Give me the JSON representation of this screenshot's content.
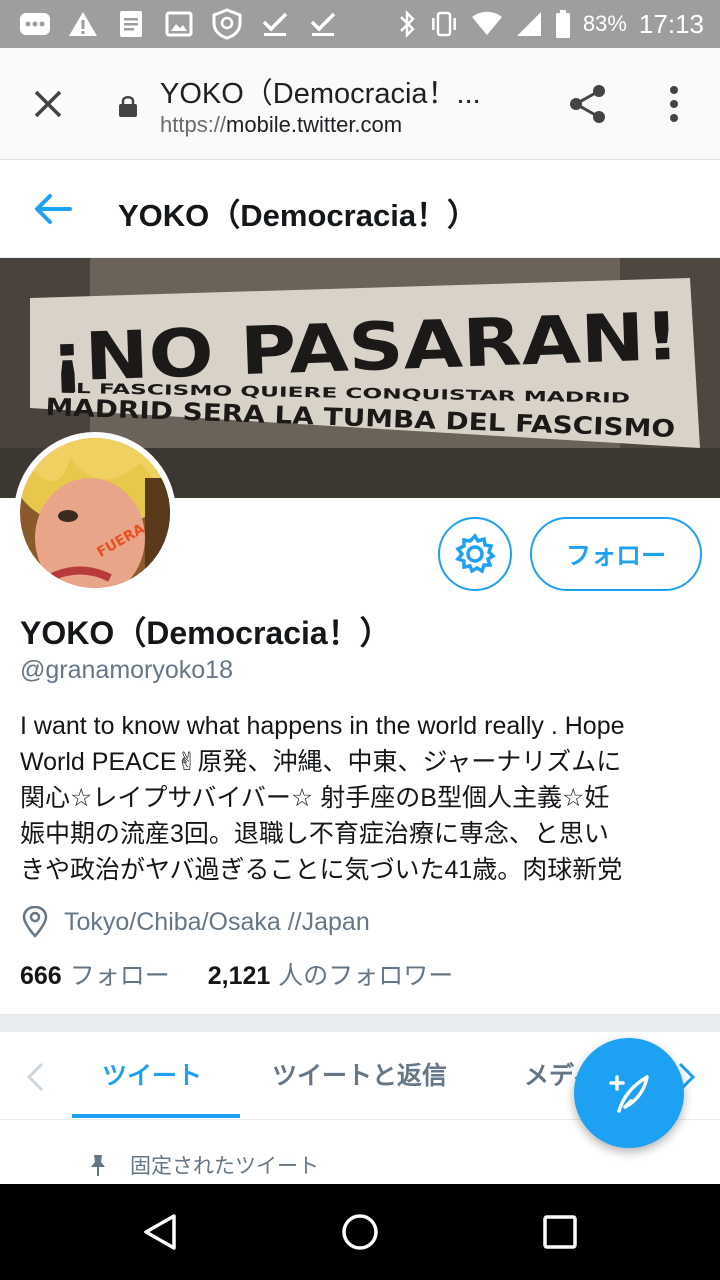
{
  "status_bar": {
    "battery": "83%",
    "time": "17:13"
  },
  "browser": {
    "title": "YOKO（Democracia！...",
    "url_scheme": "https://",
    "url_host": "mobile.twitter.com"
  },
  "header": {
    "title": "YOKO（Democracia！）"
  },
  "banner": {
    "text_main": "¡NO PASARAN!",
    "text_line2": "EL FASCISMO QUIERE CONQUISTAR MADRID",
    "text_line3": "MADRID SERA LA TUMBA DEL FASCISMO"
  },
  "avatar": {
    "face_text": "FUERA ABE"
  },
  "profile": {
    "follow_label": "フォロー",
    "name": "YOKO（Democracia！）",
    "handle": "@granamoryoko18",
    "bio": "I want to know what happens in the world really . Hope\nWorld PEACE✌原発、沖縄、中東、ジャーナリズムに\n関心☆レイプサバイバー☆ 射手座のB型個人主義☆妊\n娠中期の流産3回。退職し不育症治療に専念、と思い\nきや政治がヤバ過ぎることに気づいた41歳。肉球新党",
    "location": "Tokyo/Chiba/Osaka //Japan",
    "following_count": "666",
    "following_label": "フォロー",
    "followers_count": "2,121",
    "followers_label": "人のフォロワー"
  },
  "tabs": [
    {
      "label": "ツイート",
      "active": true
    },
    {
      "label": "ツイートと返信",
      "active": false
    },
    {
      "label": "メディア",
      "active": false
    }
  ],
  "pinned": {
    "label": "固定されたツイート"
  },
  "colors": {
    "accent": "#1da1f2",
    "secondary_text": "#657786"
  }
}
